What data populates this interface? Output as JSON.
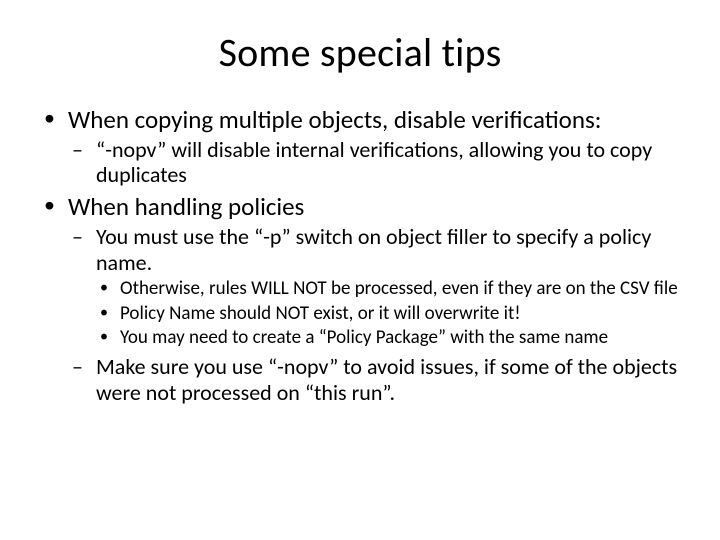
{
  "title": "Some special tips",
  "bullets": [
    {
      "text": "When copying multiple objects, disable verifications:",
      "children": [
        {
          "text": "“-nopv” will disable internal verifications,  allowing you to copy duplicates"
        }
      ]
    },
    {
      "text": "When handling policies",
      "children": [
        {
          "text": "You must use the “-p” switch on object filler to specify a policy name.",
          "children": [
            {
              "text": "Otherwise, rules WILL NOT be processed, even if they are on the CSV file"
            },
            {
              "text": "Policy Name should NOT exist, or it will overwrite it!"
            },
            {
              "text": "You may need to create a “Policy Package” with the same name"
            }
          ]
        },
        {
          "text": "Make sure you use “-nopv” to avoid issues, if some of the objects were not processed on “this run”."
        }
      ]
    }
  ]
}
